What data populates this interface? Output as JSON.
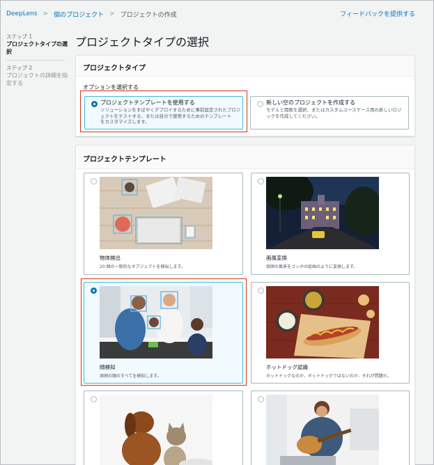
{
  "breadcrumb": {
    "items": [
      "DeepLens",
      "個のプロジェクト",
      "プロジェクトの作成"
    ],
    "separator": ">"
  },
  "feedback_link": "フィードバックを提供する",
  "sidenav": {
    "step1_label": "ステップ 1",
    "step1_title_line1": "プロジェクトタイプの選",
    "step1_title_line2": "択",
    "step2_label": "ステップ 2",
    "step2_title_line1": "プロジェクトの詳細を指",
    "step2_title_line2": "定する"
  },
  "page_title": "プロジェクトタイプの選択",
  "project_type": {
    "header": "プロジェクトタイプ",
    "options_label": "オプションを選択する",
    "options": [
      {
        "title": "プロジェクトテンプレートを使用する",
        "desc_line1": "ソリューションをすばやくデプロイするために事前設定されたプロジ",
        "desc_line2": "ェクトをテストする、または自分で使用するためのテンプレート",
        "desc_line3": "をカスタマイズします。",
        "selected": true
      },
      {
        "title": "新しい空のプロジェクトを作成する",
        "desc_line1": "モデルと関数を選択、またはカスタムユースケース用の新しいロジ",
        "desc_line2": "ックを作成してください。",
        "selected": false
      }
    ]
  },
  "templates": {
    "header": "プロジェクトテンプレート",
    "cards": [
      {
        "name": "物体検出",
        "desc": "20 個の一般的なオブジェクトを検出します。",
        "selected": false
      },
      {
        "name": "画風変換",
        "desc": "周囲の風景をゴッホの絵画のように変換します。",
        "selected": false
      },
      {
        "name": "顔検知",
        "desc": "周囲の顔のすべてを検知します。",
        "selected": true
      },
      {
        "name": "ホットドッグ認識",
        "desc": "ホットドッグなのか、ホットドッグではないのか、それが問題だ。",
        "selected": false
      },
      {
        "name": "",
        "desc": "",
        "selected": false
      },
      {
        "name": "",
        "desc": "",
        "selected": false
      }
    ]
  },
  "colors": {
    "link": "#0073bb",
    "selected_border": "#44b9d6",
    "highlight": "#d13212",
    "radio_checked": "#0073bb"
  }
}
